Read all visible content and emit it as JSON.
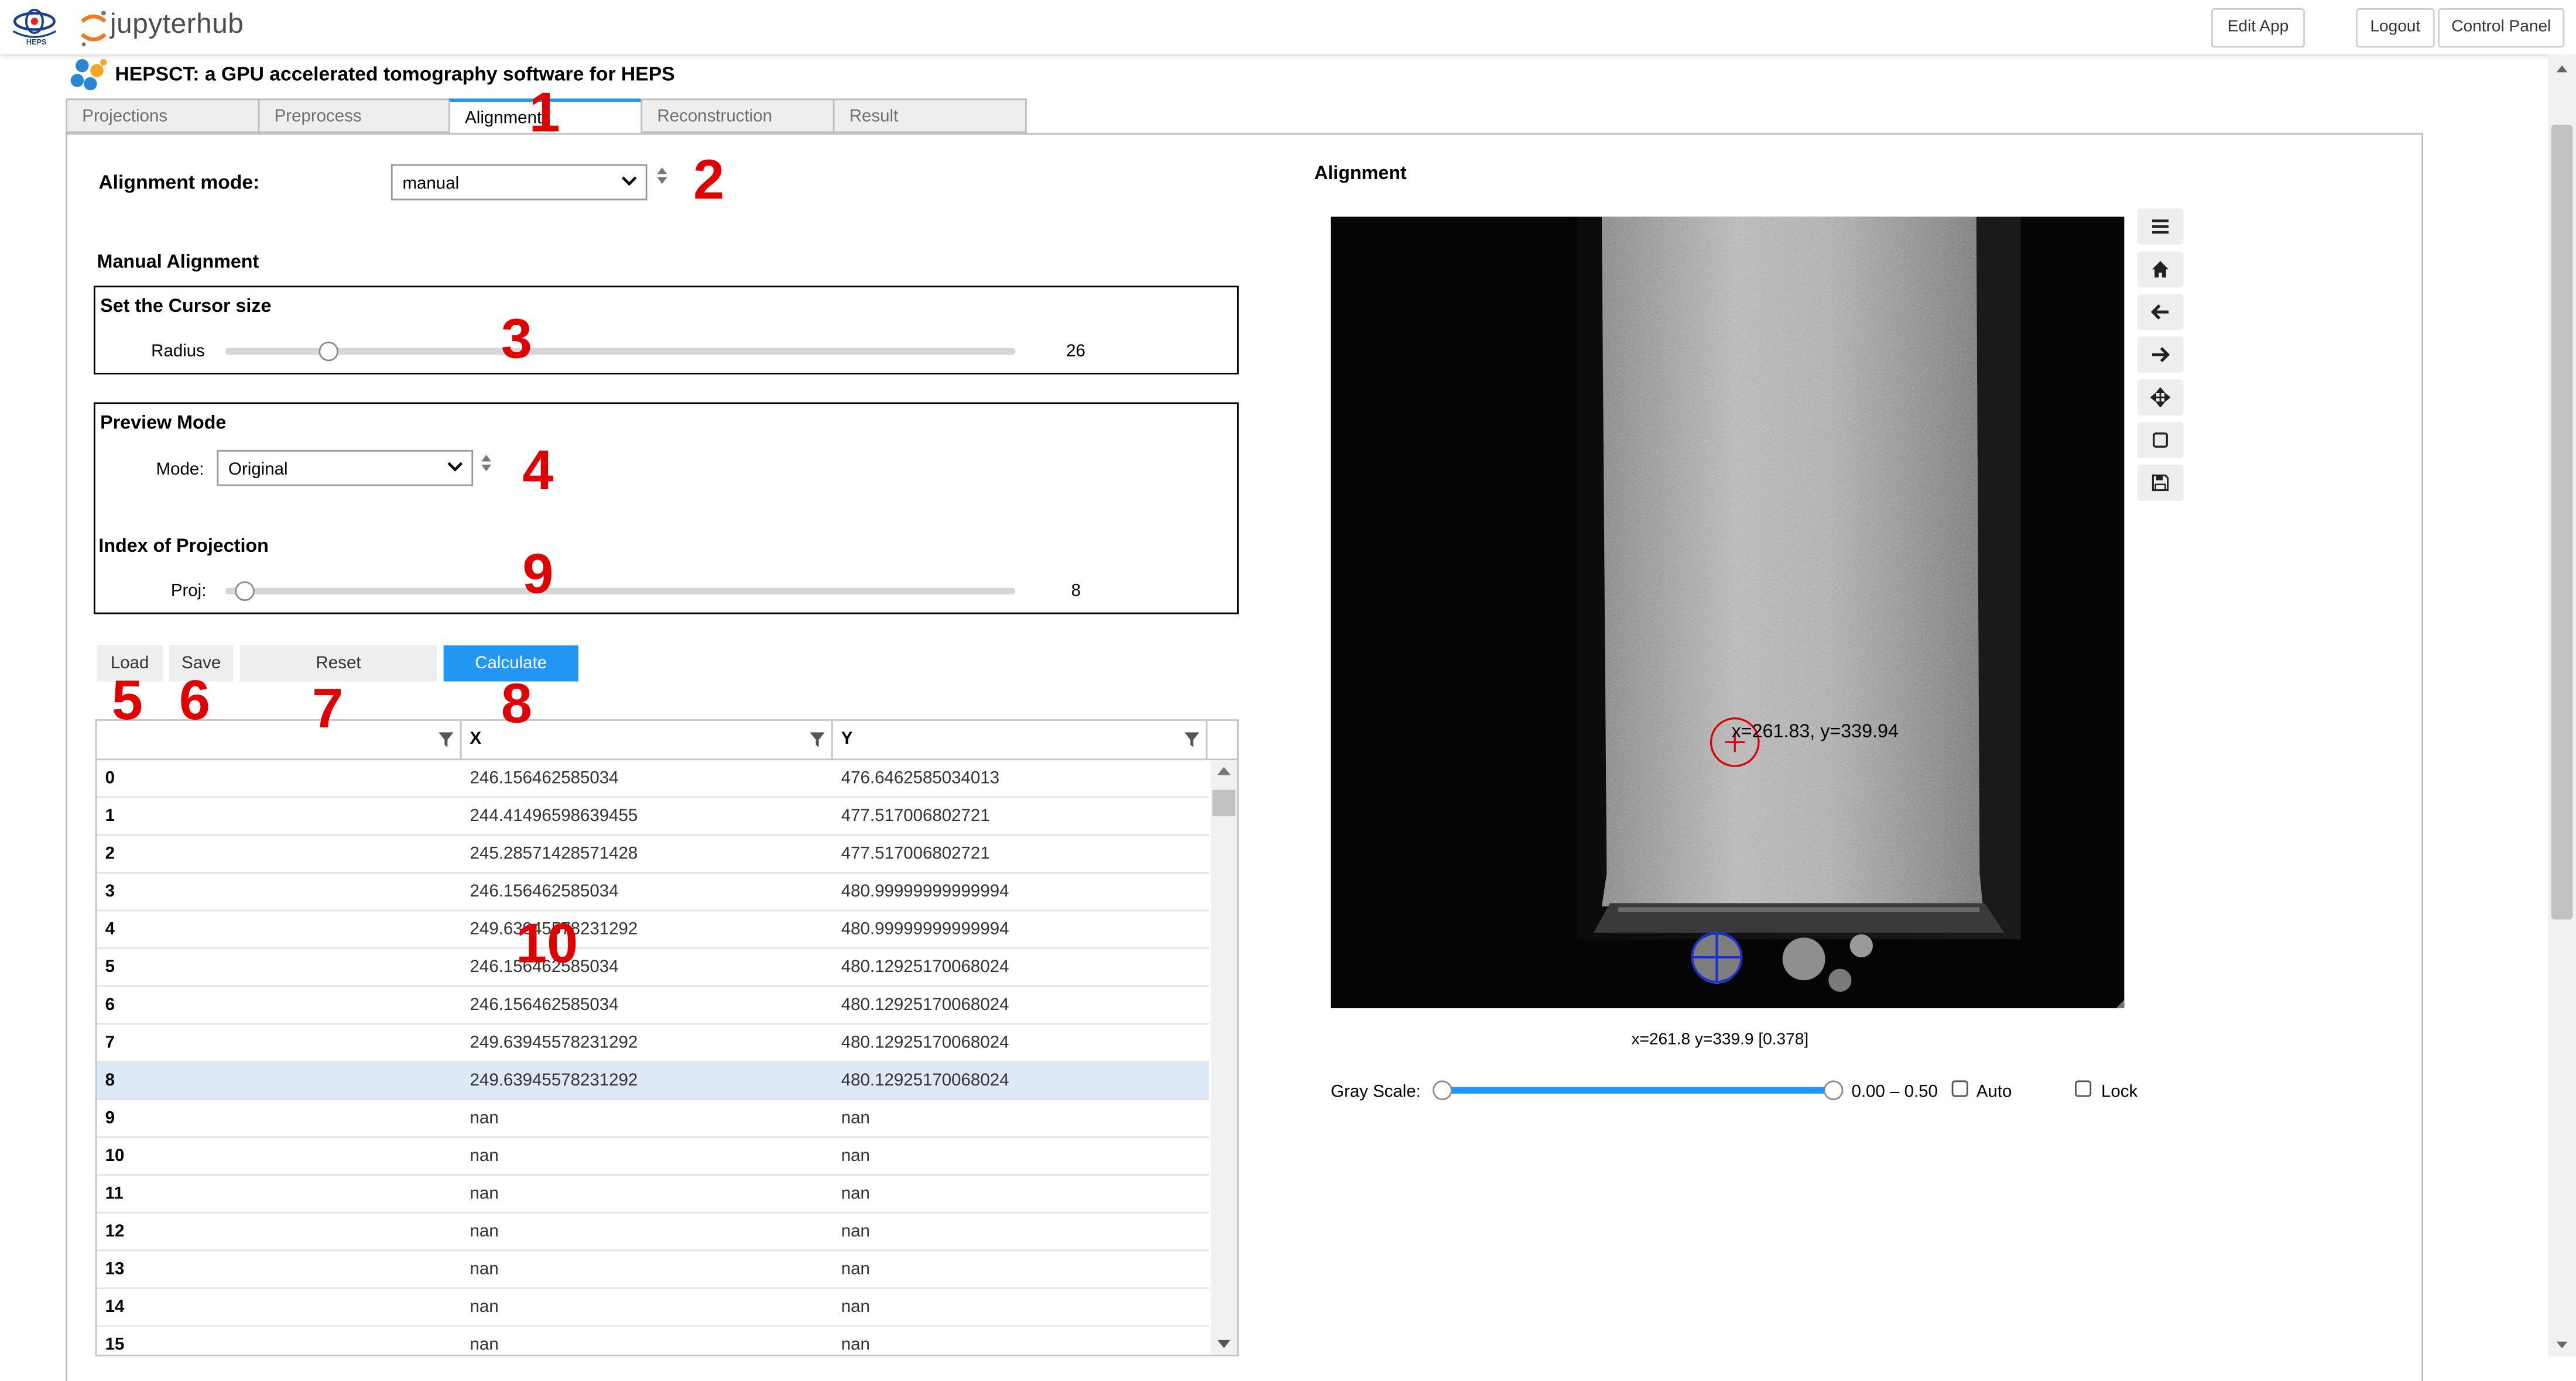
{
  "header": {
    "heps_logo_text": "HEPS",
    "brand": "jupyterhub",
    "edit_app": "Edit App",
    "logout": "Logout",
    "control_panel": "Control Panel"
  },
  "app": {
    "title": "HEPSCT: a GPU accelerated tomography software for HEPS"
  },
  "tabs": [
    "Projections",
    "Preprocess",
    "Alignment",
    "Reconstruction",
    "Result"
  ],
  "active_tab": "Alignment",
  "left": {
    "alignment_mode_label": "Alignment mode:",
    "alignment_mode_value": "manual",
    "manual_alignment_heading": "Manual Alignment",
    "cursor_box_heading": "Set the Cursor size",
    "radius_label": "Radius",
    "radius_value": "26",
    "radius_fraction": 0.13,
    "preview_heading": "Preview Mode",
    "mode_label": "Mode:",
    "mode_value": "Original",
    "index_heading": "Index of Projection",
    "proj_label": "Proj:",
    "proj_value": "8",
    "proj_fraction": 0.025,
    "buttons": {
      "load": "Load",
      "save": "Save",
      "reset": "Reset",
      "calculate": "Calculate"
    }
  },
  "table": {
    "columns": [
      "",
      "X",
      "Y"
    ],
    "rows": [
      [
        "0",
        "246.156462585034",
        "476.6462585034013"
      ],
      [
        "1",
        "244.41496598639455",
        "477.517006802721"
      ],
      [
        "2",
        "245.28571428571428",
        "477.517006802721"
      ],
      [
        "3",
        "246.156462585034",
        "480.99999999999994"
      ],
      [
        "4",
        "249.63945578231292",
        "480.99999999999994"
      ],
      [
        "5",
        "246.156462585034",
        "480.12925170068024"
      ],
      [
        "6",
        "246.156462585034",
        "480.12925170068024"
      ],
      [
        "7",
        "249.63945578231292",
        "480.12925170068024"
      ],
      [
        "8",
        "249.63945578231292",
        "480.12925170068024"
      ],
      [
        "9",
        "nan",
        "nan"
      ],
      [
        "10",
        "nan",
        "nan"
      ],
      [
        "11",
        "nan",
        "nan"
      ],
      [
        "12",
        "nan",
        "nan"
      ],
      [
        "13",
        "nan",
        "nan"
      ],
      [
        "14",
        "nan",
        "nan"
      ],
      [
        "15",
        "nan",
        "nan"
      ]
    ],
    "selected_row": "8"
  },
  "right": {
    "heading": "Alignment",
    "cursor_annotation": "x=261.83, y=339.94",
    "status_readout": "x=261.8 y=339.9 [0.378]",
    "gray_scale_label": "Gray Scale:",
    "gray_scale_value": "0.00 – 0.50",
    "auto_label": "Auto",
    "lock_label": "Lock"
  },
  "toolbar_icons": [
    "menu-icon",
    "home-icon",
    "back-arrow-icon",
    "forward-arrow-icon",
    "pan-icon",
    "zoom-rect-icon",
    "save-icon"
  ],
  "callouts": [
    "1",
    "2",
    "3",
    "4",
    "5",
    "6",
    "7",
    "8",
    "9",
    "10"
  ],
  "colors": {
    "accent": "#2196f3",
    "callout": "#e00000",
    "selected_row": "#dde9f7"
  }
}
